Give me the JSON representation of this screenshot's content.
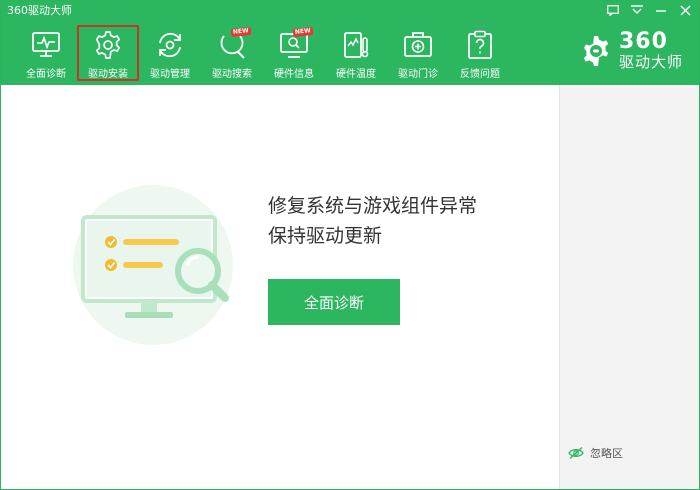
{
  "window": {
    "title": "360驱动大师"
  },
  "toolbar": {
    "items": [
      {
        "label": "全面诊断",
        "icon": "monitor-pulse-icon"
      },
      {
        "label": "驱动安装",
        "icon": "gear-icon"
      },
      {
        "label": "驱动管理",
        "icon": "refresh-circle-icon"
      },
      {
        "label": "驱动搜索",
        "icon": "search-icon",
        "badge": "NEW"
      },
      {
        "label": "硬件信息",
        "icon": "monitor-search-icon",
        "badge": "NEW"
      },
      {
        "label": "硬件温度",
        "icon": "device-thermometer-icon"
      },
      {
        "label": "驱动门诊",
        "icon": "medical-kit-icon"
      },
      {
        "label": "反馈问题",
        "icon": "question-clipboard-icon"
      }
    ],
    "selected_index": 1
  },
  "brand": {
    "number": "360",
    "subtitle": "驱动大师"
  },
  "main": {
    "headline_line1": "修复系统与游戏组件异常",
    "headline_line2": "保持驱动更新",
    "cta_label": "全面诊断"
  },
  "side": {
    "ignore_label": "忽略区"
  },
  "colors": {
    "brand_green": "#2cb65f",
    "selected_outline": "#c0392b",
    "badge_red": "#e53935"
  }
}
